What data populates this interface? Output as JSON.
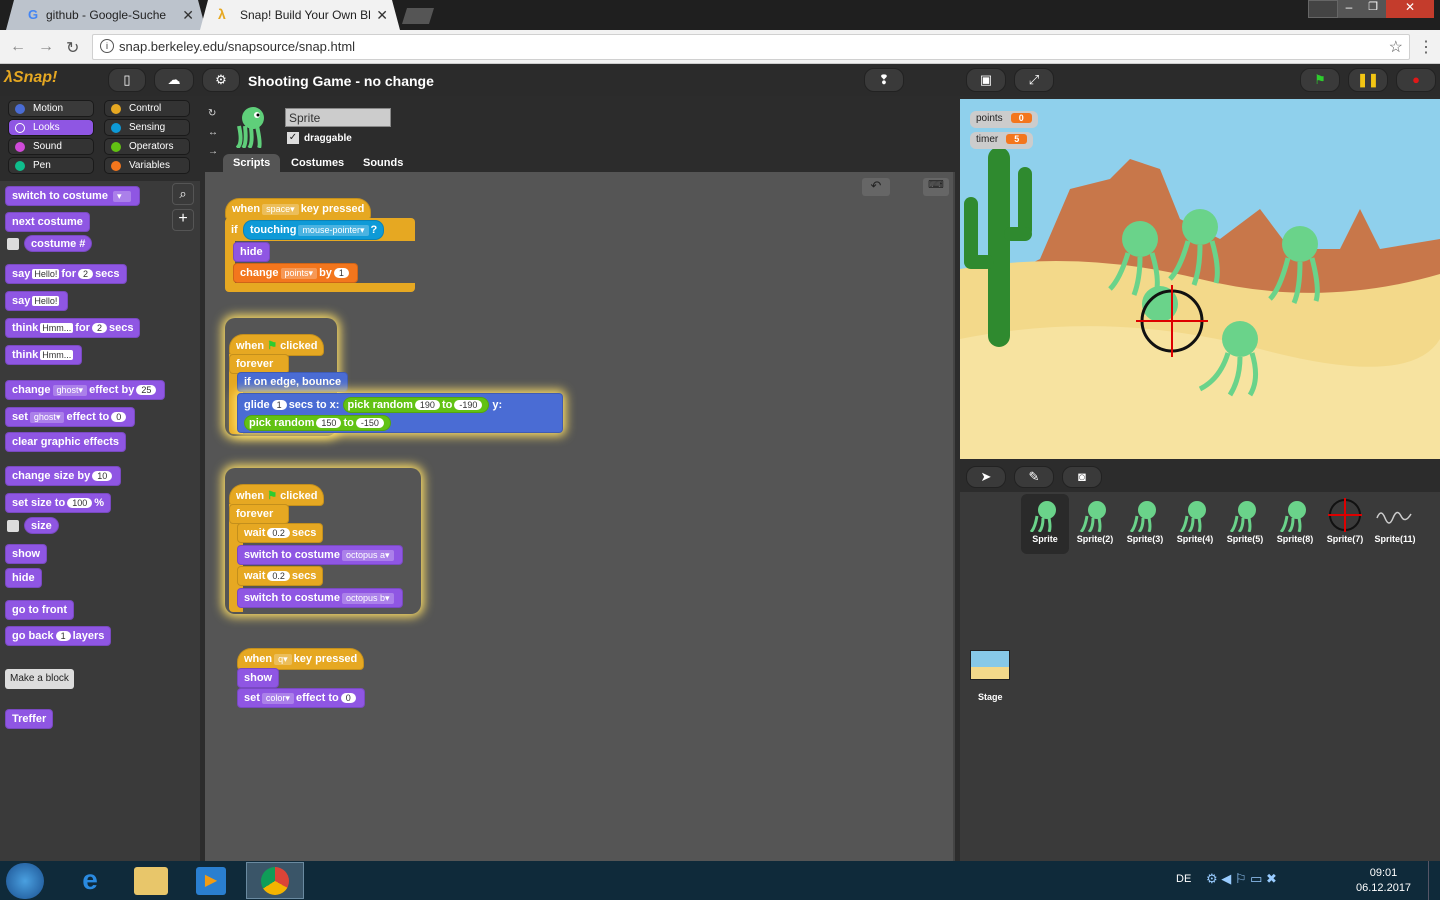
{
  "browser": {
    "tabs": [
      {
        "title": "github - Google-Suche"
      },
      {
        "title": "Snap! Build Your Own Bl"
      }
    ],
    "url": "snap.berkeley.edu/snapsource/snap.html",
    "close_glyph": "✕"
  },
  "snap": {
    "project_title": "Shooting Game - no change",
    "categories": [
      "Motion",
      "Control",
      "Looks",
      "Sensing",
      "Sound",
      "Operators",
      "Pen",
      "Variables"
    ],
    "category_colors": {
      "Motion": "#4a6cd4",
      "Looks": "#8f56e3",
      "Sound": "#cf4ad9",
      "Pen": "#0fbd8c",
      "Control": "#e6a822",
      "Sensing": "#0e9ad7",
      "Operators": "#62c213",
      "Variables": "#f3761d"
    },
    "palette": {
      "switch_to_costume": "switch to costume",
      "next_costume": "next costume",
      "costume_num": "costume #",
      "say": "say",
      "for": "for",
      "secs": "secs",
      "hello": "Hello!",
      "two": "2",
      "think": "think",
      "hmm": "Hmm...",
      "change": "change",
      "ghost": "ghost",
      "effect_by": "effect by",
      "twentyfive": "25",
      "set": "set",
      "effect_to": "effect to",
      "zero": "0",
      "clear_graphic_effects": "clear graphic effects",
      "change_size_by": "change size by",
      "ten": "10",
      "set_size_to": "set size to",
      "hundred": "100",
      "percent": "%",
      "size": "size",
      "show": "show",
      "hide": "hide",
      "go_to_front": "go to front",
      "go_back": "go back",
      "one": "1",
      "layers": "layers",
      "make_a_block": "Make a block",
      "treffer": "Treffer"
    },
    "sprite": {
      "name": "Sprite",
      "draggable_label": "draggable",
      "tabs": [
        "Scripts",
        "Costumes",
        "Sounds"
      ]
    },
    "scripts": {
      "when": "when",
      "key_pressed": "key pressed",
      "space": "space",
      "if": "if",
      "touching": "touching",
      "mouse_pointer": "mouse-pointer",
      "q_mark": "?",
      "hide": "hide",
      "change": "change",
      "points": "points",
      "by": "by",
      "one": "1",
      "clicked": "clicked",
      "forever": "forever",
      "if_on_edge": "if on edge, bounce",
      "glide": "glide",
      "secs_to_x": "secs to x:",
      "pick_random": "pick random",
      "r190": "190",
      "rm190": "-190",
      "y": "y:",
      "r150": "150",
      "rm150": "-150",
      "to": "to",
      "wait": "wait",
      "point2": "0.2",
      "secs": "secs",
      "switch_to_costume": "switch to costume",
      "octopus_a": "octopus a",
      "octopus_b": "octopus b",
      "q": "q",
      "show": "show",
      "set": "set",
      "color": "color",
      "effect_to": "effect to",
      "zero": "0"
    },
    "watchers": [
      {
        "label": "points",
        "value": "0"
      },
      {
        "label": "timer",
        "value": "5"
      }
    ],
    "sprites": [
      "Sprite",
      "Sprite(2)",
      "Sprite(3)",
      "Sprite(4)",
      "Sprite(5)",
      "Sprite(8)",
      "Sprite(7)",
      "Sprite(11)"
    ],
    "stage_label": "Stage"
  },
  "taskbar": {
    "lang": "DE",
    "time": "09:01",
    "date": "06.12.2017"
  }
}
